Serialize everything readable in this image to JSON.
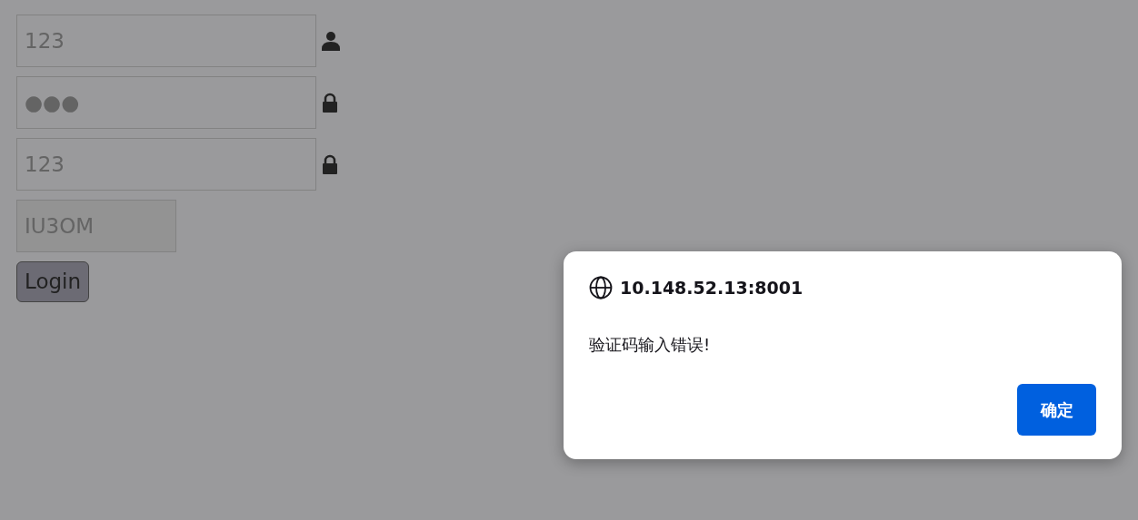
{
  "form": {
    "fields": [
      {
        "kind": "account",
        "value": "123",
        "disabled": false
      },
      {
        "kind": "password",
        "value": "●●●",
        "disabled": false
      },
      {
        "kind": "confirm",
        "value": "123",
        "disabled": false
      },
      {
        "kind": "captcha",
        "value": "IU3OM",
        "disabled": true
      }
    ],
    "button": "Login"
  },
  "dialog": {
    "title": "10.148.52.13:8001",
    "message": "验证码输入错误!",
    "button": "确定"
  }
}
